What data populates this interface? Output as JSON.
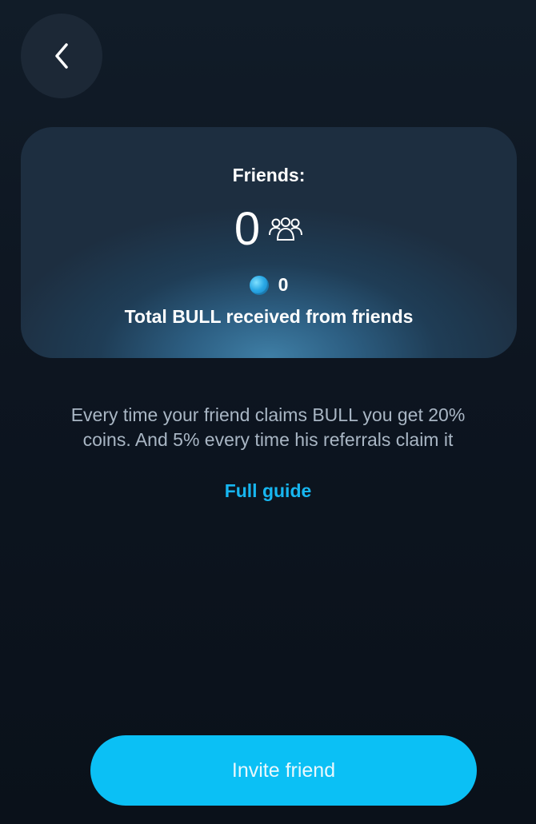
{
  "header": {
    "back_icon": "chevron-left-icon"
  },
  "stats": {
    "friends_label": "Friends:",
    "friends_count": "0",
    "friends_icon": "group-icon",
    "coin_icon": "coin-icon",
    "bull_amount": "0",
    "bull_caption": "Total BULL received from friends"
  },
  "info": {
    "line1": "Every time your friend claims BULL you get 20%",
    "line2": "coins. And 5% every time his referrals claim it",
    "guide_link": "Full guide"
  },
  "actions": {
    "invite_label": "Invite friend"
  },
  "colors": {
    "accent": "#0bc0f5",
    "link": "#17b6f0",
    "background": "#0d1520",
    "card": "#1d2e40"
  }
}
